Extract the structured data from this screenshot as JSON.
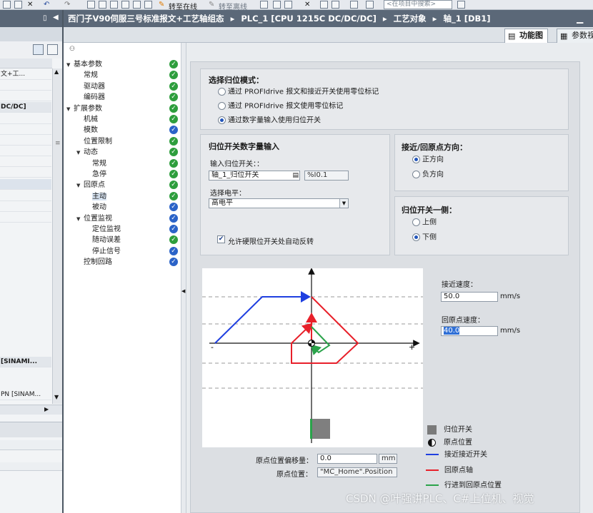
{
  "toolbar": {
    "go_online": "转至在线",
    "go_offline": "转至离线",
    "search_placeholder": "<在项目中搜索>"
  },
  "left_pane": {
    "rows": [
      {
        "text": "文+工..."
      },
      {
        "text": "DC/DC]"
      },
      {
        "text": "[SINAMI..."
      },
      {
        "text": "PN [SINAM..."
      }
    ]
  },
  "breadcrumb": {
    "project": "西门子V90伺服三号标准报文+工艺轴组态",
    "plc": "PLC_1 [CPU 1215C DC/DC/DC]",
    "tech_objects": "工艺对象",
    "axis": "轴_1 [DB1]",
    "separator": "▸"
  },
  "tabs": {
    "function_view": "功能图",
    "param_view": "参数视"
  },
  "nav": [
    {
      "label": "基本参数",
      "level": 0,
      "expand": "▼",
      "status": "ok"
    },
    {
      "label": "常规",
      "level": 1,
      "status": "ok"
    },
    {
      "label": "驱动器",
      "level": 1,
      "status": "ok"
    },
    {
      "label": "编码器",
      "level": 1,
      "status": "ok"
    },
    {
      "label": "扩展参数",
      "level": 0,
      "expand": "▼",
      "status": "ok"
    },
    {
      "label": "机械",
      "level": 1,
      "status": "ok"
    },
    {
      "label": "模数",
      "level": 1,
      "status": "info"
    },
    {
      "label": "位置限制",
      "level": 1,
      "status": "ok"
    },
    {
      "label": "动态",
      "level": 1,
      "expand": "▼",
      "status": "ok"
    },
    {
      "label": "常规",
      "level": 2,
      "status": "ok"
    },
    {
      "label": "急停",
      "level": 2,
      "status": "ok"
    },
    {
      "label": "回原点",
      "level": 1,
      "expand": "▼",
      "status": "ok"
    },
    {
      "label": "主动",
      "level": 2,
      "status": "ok",
      "selected": true
    },
    {
      "label": "被动",
      "level": 2,
      "status": "info"
    },
    {
      "label": "位置监视",
      "level": 1,
      "expand": "▼",
      "status": "info"
    },
    {
      "label": "定位监视",
      "level": 2,
      "status": "info"
    },
    {
      "label": "随动误差",
      "level": 2,
      "status": "ok"
    },
    {
      "label": "停止信号",
      "level": 2,
      "status": "info"
    },
    {
      "label": "控制回路",
      "level": 1,
      "status": "info"
    }
  ],
  "homing_mode": {
    "title": "选择归位模式：",
    "options": [
      "通过 PROFIdrive 报文和接近开关使用零位标记",
      "通过 PROFIdrive 报文使用零位标记",
      "通过数字量输入使用归位开关"
    ],
    "selected_index": 2
  },
  "home_switch_input": {
    "title": "归位开关数字量输入",
    "input_label": "输入归位开关：：",
    "input_value": "轴_1_归位开关",
    "address": "%I0.1",
    "level_label": "选择电平：",
    "level_value": "高电平",
    "auto_reverse_label": "允许硬限位开关处自动反转",
    "auto_reverse_checked": true,
    "check_glyph": "✔"
  },
  "approach_direction": {
    "title": "接近/回原点方向：",
    "options": [
      "正方向",
      "负方向"
    ],
    "selected_index": 0
  },
  "switch_side": {
    "title": "归位开关一侧：",
    "options": [
      "上侧",
      "下侧"
    ],
    "selected_index": 1
  },
  "diagram": {
    "approach_velocity_label": "接近速度：",
    "approach_velocity_value": "50.0",
    "homing_velocity_label": "回原点速度：",
    "homing_velocity_value": "40.0",
    "unit": "mm/s",
    "minus": "-",
    "plus": "+",
    "colors": {
      "approach": "#1f3fe0",
      "homing": "#e8202a",
      "creep": "#2aa34a",
      "switch": "#7a7a7a"
    }
  },
  "offset": {
    "label": "原点位置偏移量：",
    "value": "0.0",
    "unit": "mm",
    "position_label": "原点位置：",
    "position_value": "\"MC_Home\".Position"
  },
  "legend": [
    {
      "label": "归位开关",
      "icon": "gray-square"
    },
    {
      "label": "原点位置",
      "icon": "origin-cross"
    },
    {
      "label": "接近接近开关",
      "icon": "blue-line"
    },
    {
      "label": "回原点轴",
      "icon": "red-line"
    },
    {
      "label": "行进到回原点位置",
      "icon": "green-line"
    }
  ],
  "watermark": "CSDN @叶强讲PLC、C#上位机、视觉"
}
